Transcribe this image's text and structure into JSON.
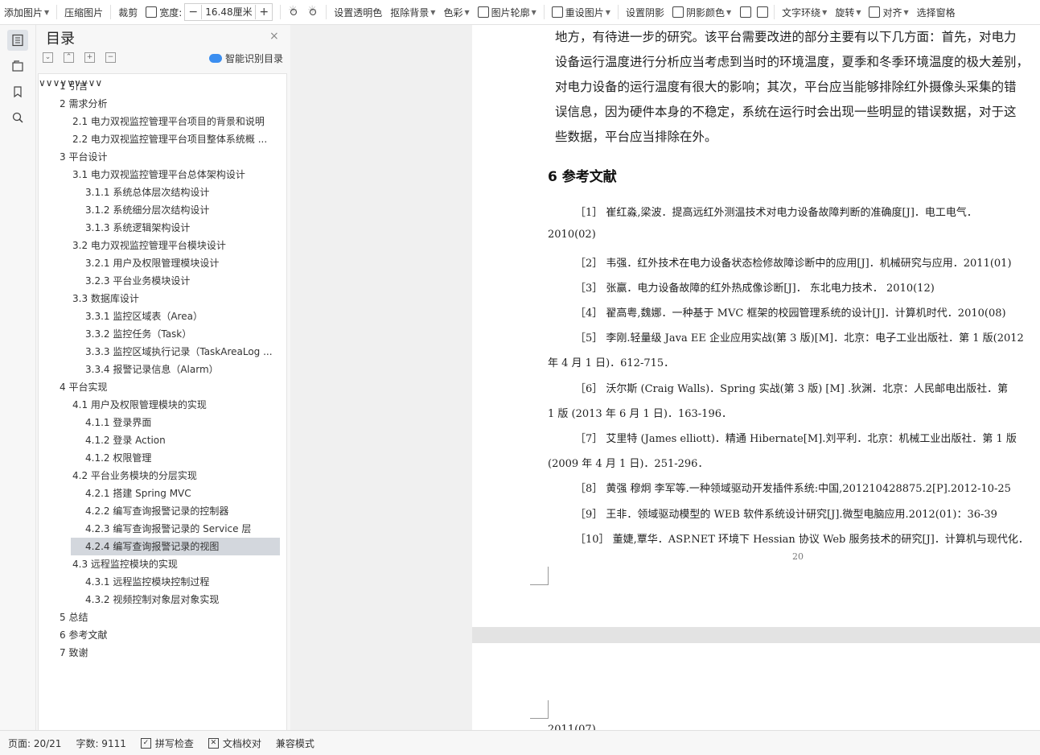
{
  "toolbar": {
    "add_picture": "添加图片",
    "compress": "压缩图片",
    "crop": "裁剪",
    "width_label": "宽度:",
    "width_minus": "−",
    "width_value": "16.48厘米",
    "width_plus": "+",
    "set_transparent": "设置透明色",
    "remove_bg": "抠除背景",
    "color": "色彩",
    "outline": "图片轮廓",
    "reset": "重设图片",
    "shadow": "设置阴影",
    "shadow_color": "阴影颜色",
    "text_wrap": "文字环绕",
    "rotate": "旋转",
    "align": "对齐",
    "select_pane": "选择窗格"
  },
  "toc": {
    "title": "目录",
    "close": "×",
    "smart": "智能识别目录",
    "items": [
      {
        "text": "1  引言"
      },
      {
        "text": "2  需求分析"
      },
      {
        "text": "2.1 电力双视监控管理平台项目的背景和说明"
      },
      {
        "text": "2.2  电力双视监控管理平台项目整体系统概 ..."
      },
      {
        "text": "3  平台设计"
      },
      {
        "text": "3.1  电力双视监控管理平台总体架构设计"
      },
      {
        "text": "3.1.1  系统总体层次结构设计"
      },
      {
        "text": "3.1.2 系统细分层次结构设计"
      },
      {
        "text": "3.1.3  系统逻辑架构设计"
      },
      {
        "text": "3.2  电力双视监控管理平台模块设计"
      },
      {
        "text": "3.2.1  用户及权限管理模块设计"
      },
      {
        "text": "3.2.3  平台业务模块设计"
      },
      {
        "text": "3.3  数据库设计"
      },
      {
        "text": "3.3.1  监控区域表（Area）"
      },
      {
        "text": "3.3.2  监控任务（Task）"
      },
      {
        "text": "3.3.3  监控区域执行记录（TaskAreaLog ..."
      },
      {
        "text": "3.3.4  报警记录信息（Alarm）"
      },
      {
        "text": "4  平台实现"
      },
      {
        "text": "4.1 用户及权限管理模块的实现"
      },
      {
        "text": "4.1.1  登录界面"
      },
      {
        "text": "4.1.2 登录 Action"
      },
      {
        "text": "4.1.2  权限管理"
      },
      {
        "text": "4.2  平台业务模块的分层实现"
      },
      {
        "text": "4.2.1  搭建 Spring MVC"
      },
      {
        "text": "4.2.2  编写查询报警记录的控制器"
      },
      {
        "text": "4.2.3  编写查询报警记录的 Service 层"
      },
      {
        "text": "4.2.4  编写查询报警记录的视图"
      },
      {
        "text": "4.3  远程监控模块的实现"
      },
      {
        "text": "4.3.1  远程监控模块控制过程"
      },
      {
        "text": "4.3.2  视频控制对象层对象实现"
      },
      {
        "text": "5  总结"
      },
      {
        "text": "6  参考文献"
      },
      {
        "text": "7  致谢"
      }
    ]
  },
  "doc": {
    "para_lines": [
      "地方，有待进一步的研究。该平台需要改进的部分主要有以下几方面：首先，对电力",
      "设备运行温度进行分析应当考虑到当时的环境温度，夏季和冬季环境温度的极大差别，",
      "对电力设备的运行温度有很大的影响；其次，平台应当能够排除红外摄像头采集的错",
      "误信息，因为硬件本身的不稳定，系统在运行时会出现一些明显的错误数据，对于这",
      "些数据，平台应当排除在外。"
    ],
    "heading": "6  参考文献",
    "refs": [
      "［1］ 崔红淼,梁波．提高远红外测温技术对电力设备故障判断的准确度[J]．电工电气．",
      "2010(02)",
      "［2］ 韦强．红外技术在电力设备状态检修故障诊断中的应用[J]．机械研究与应用．2011(01)",
      "［3］ 张赢．电力设备故障的红外热成像诊断[J]．  东北电力技术．  2010(12)",
      "［4］ 翟高粤,魏娜．一种基于 MVC 框架的校园管理系统的设计[J]．计算机时代．2010(08)",
      "［5］ 李刚.轻量级 Java EE 企业应用实战(第 3 版)[M]．北京：电子工业出版社．第 1 版(2012",
      "年 4 月 1 日)．612-715．",
      "［6］  沃尔斯 (Craig Walls)．Spring 实战(第 3 版) [M] .狄渊．北京：人民邮电出版社．第",
      "1 版 (2013 年 6 月 1 日)．163-196．",
      "［7］ 艾里特 (James elliott)．精通 Hibernate[M].刘平利．北京：机械工业出版社．第 1 版",
      "(2009 年 4 月 1 日)．251-296．",
      "［8］ 黄强  穆炯  李军等.一种领域驱动开发插件系统:中国,201210428875.2[P].2012-10-25",
      "［9］ 王非．领域驱动模型的 WEB 软件系统设计研究[J].微型电脑应用.2012(01)：36-39",
      "［10］ 董婕,覃华．ASP.NET 环境下 Hessian 协议 Web 服务技术的研究[J]．计算机与现代化．"
    ],
    "page_number": "20",
    "next_page_line": "2011(07)"
  },
  "status": {
    "page": "页面: 20/21",
    "words": "字数: 9111",
    "spell": "拼写检查",
    "proof": "文档校对",
    "compat": "兼容模式"
  }
}
